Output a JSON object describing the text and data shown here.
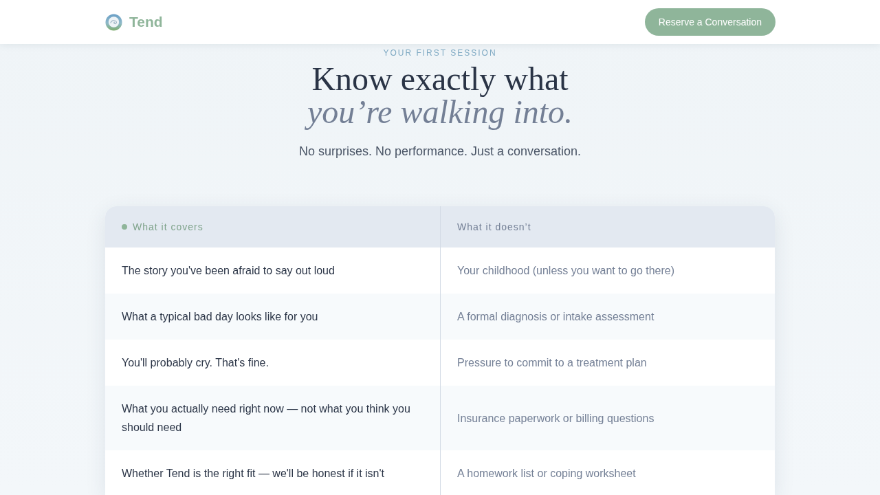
{
  "header": {
    "brand": "Tend",
    "cta": "Reserve a Conversation"
  },
  "hero": {
    "eyebrow": "YOUR FIRST SESSION",
    "title_line_1": "Know exactly what",
    "title_line_2": "you’re walking into.",
    "subtitle": "No surprises. No performance. Just a conversation."
  },
  "comparison": {
    "columns": [
      {
        "label": "What it covers",
        "kind": "covers"
      },
      {
        "label": "What it doesn’t",
        "kind": "excludes"
      }
    ],
    "rows": [
      {
        "covers": "The story you've been afraid to say out loud",
        "excludes": "Your childhood (unless you want to go there)"
      },
      {
        "covers": "What a typical bad day looks like for you",
        "excludes": "A formal diagnosis or intake assessment"
      },
      {
        "covers": "You'll probably cry. That's fine.",
        "excludes": "Pressure to commit to a treatment plan"
      },
      {
        "covers": "What you actually need right now — not what you think you should need",
        "excludes": "Insurance paperwork or billing questions"
      },
      {
        "covers": "Whether Tend is the right fit — we'll be honest if it isn't",
        "excludes": "A homework list or coping worksheet"
      }
    ]
  }
}
